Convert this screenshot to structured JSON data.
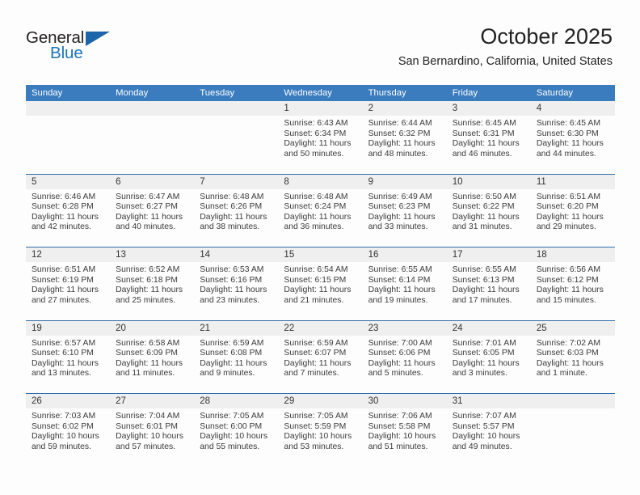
{
  "brand": {
    "word_one": "General",
    "word_two": "Blue",
    "triangle_color": "#1c65ab",
    "blue_color": "#1c75bc"
  },
  "header": {
    "title": "October 2025",
    "location": "San Bernardino, California, United States"
  },
  "theme": {
    "header_row_bg": "#3a7cbe",
    "row_divider": "#2f6fa8",
    "day_number_bg": "#efefef",
    "page_bg": "#fdfdfd"
  },
  "weekdays": [
    "Sunday",
    "Monday",
    "Tuesday",
    "Wednesday",
    "Thursday",
    "Friday",
    "Saturday"
  ],
  "weeks": [
    [
      {
        "day": "",
        "blank": true,
        "sunrise": "",
        "sunset": "",
        "daylight_1": "",
        "daylight_2": ""
      },
      {
        "day": "",
        "blank": true,
        "sunrise": "",
        "sunset": "",
        "daylight_1": "",
        "daylight_2": ""
      },
      {
        "day": "",
        "blank": true,
        "sunrise": "",
        "sunset": "",
        "daylight_1": "",
        "daylight_2": ""
      },
      {
        "day": "1",
        "sunrise": "Sunrise: 6:43 AM",
        "sunset": "Sunset: 6:34 PM",
        "daylight_1": "Daylight: 11 hours",
        "daylight_2": "and 50 minutes."
      },
      {
        "day": "2",
        "sunrise": "Sunrise: 6:44 AM",
        "sunset": "Sunset: 6:32 PM",
        "daylight_1": "Daylight: 11 hours",
        "daylight_2": "and 48 minutes."
      },
      {
        "day": "3",
        "sunrise": "Sunrise: 6:45 AM",
        "sunset": "Sunset: 6:31 PM",
        "daylight_1": "Daylight: 11 hours",
        "daylight_2": "and 46 minutes."
      },
      {
        "day": "4",
        "sunrise": "Sunrise: 6:45 AM",
        "sunset": "Sunset: 6:30 PM",
        "daylight_1": "Daylight: 11 hours",
        "daylight_2": "and 44 minutes."
      }
    ],
    [
      {
        "day": "5",
        "sunrise": "Sunrise: 6:46 AM",
        "sunset": "Sunset: 6:28 PM",
        "daylight_1": "Daylight: 11 hours",
        "daylight_2": "and 42 minutes."
      },
      {
        "day": "6",
        "sunrise": "Sunrise: 6:47 AM",
        "sunset": "Sunset: 6:27 PM",
        "daylight_1": "Daylight: 11 hours",
        "daylight_2": "and 40 minutes."
      },
      {
        "day": "7",
        "sunrise": "Sunrise: 6:48 AM",
        "sunset": "Sunset: 6:26 PM",
        "daylight_1": "Daylight: 11 hours",
        "daylight_2": "and 38 minutes."
      },
      {
        "day": "8",
        "sunrise": "Sunrise: 6:48 AM",
        "sunset": "Sunset: 6:24 PM",
        "daylight_1": "Daylight: 11 hours",
        "daylight_2": "and 36 minutes."
      },
      {
        "day": "9",
        "sunrise": "Sunrise: 6:49 AM",
        "sunset": "Sunset: 6:23 PM",
        "daylight_1": "Daylight: 11 hours",
        "daylight_2": "and 33 minutes."
      },
      {
        "day": "10",
        "sunrise": "Sunrise: 6:50 AM",
        "sunset": "Sunset: 6:22 PM",
        "daylight_1": "Daylight: 11 hours",
        "daylight_2": "and 31 minutes."
      },
      {
        "day": "11",
        "sunrise": "Sunrise: 6:51 AM",
        "sunset": "Sunset: 6:20 PM",
        "daylight_1": "Daylight: 11 hours",
        "daylight_2": "and 29 minutes."
      }
    ],
    [
      {
        "day": "12",
        "sunrise": "Sunrise: 6:51 AM",
        "sunset": "Sunset: 6:19 PM",
        "daylight_1": "Daylight: 11 hours",
        "daylight_2": "and 27 minutes."
      },
      {
        "day": "13",
        "sunrise": "Sunrise: 6:52 AM",
        "sunset": "Sunset: 6:18 PM",
        "daylight_1": "Daylight: 11 hours",
        "daylight_2": "and 25 minutes."
      },
      {
        "day": "14",
        "sunrise": "Sunrise: 6:53 AM",
        "sunset": "Sunset: 6:16 PM",
        "daylight_1": "Daylight: 11 hours",
        "daylight_2": "and 23 minutes."
      },
      {
        "day": "15",
        "sunrise": "Sunrise: 6:54 AM",
        "sunset": "Sunset: 6:15 PM",
        "daylight_1": "Daylight: 11 hours",
        "daylight_2": "and 21 minutes."
      },
      {
        "day": "16",
        "sunrise": "Sunrise: 6:55 AM",
        "sunset": "Sunset: 6:14 PM",
        "daylight_1": "Daylight: 11 hours",
        "daylight_2": "and 19 minutes."
      },
      {
        "day": "17",
        "sunrise": "Sunrise: 6:55 AM",
        "sunset": "Sunset: 6:13 PM",
        "daylight_1": "Daylight: 11 hours",
        "daylight_2": "and 17 minutes."
      },
      {
        "day": "18",
        "sunrise": "Sunrise: 6:56 AM",
        "sunset": "Sunset: 6:12 PM",
        "daylight_1": "Daylight: 11 hours",
        "daylight_2": "and 15 minutes."
      }
    ],
    [
      {
        "day": "19",
        "sunrise": "Sunrise: 6:57 AM",
        "sunset": "Sunset: 6:10 PM",
        "daylight_1": "Daylight: 11 hours",
        "daylight_2": "and 13 minutes."
      },
      {
        "day": "20",
        "sunrise": "Sunrise: 6:58 AM",
        "sunset": "Sunset: 6:09 PM",
        "daylight_1": "Daylight: 11 hours",
        "daylight_2": "and 11 minutes."
      },
      {
        "day": "21",
        "sunrise": "Sunrise: 6:59 AM",
        "sunset": "Sunset: 6:08 PM",
        "daylight_1": "Daylight: 11 hours",
        "daylight_2": "and 9 minutes."
      },
      {
        "day": "22",
        "sunrise": "Sunrise: 6:59 AM",
        "sunset": "Sunset: 6:07 PM",
        "daylight_1": "Daylight: 11 hours",
        "daylight_2": "and 7 minutes."
      },
      {
        "day": "23",
        "sunrise": "Sunrise: 7:00 AM",
        "sunset": "Sunset: 6:06 PM",
        "daylight_1": "Daylight: 11 hours",
        "daylight_2": "and 5 minutes."
      },
      {
        "day": "24",
        "sunrise": "Sunrise: 7:01 AM",
        "sunset": "Sunset: 6:05 PM",
        "daylight_1": "Daylight: 11 hours",
        "daylight_2": "and 3 minutes."
      },
      {
        "day": "25",
        "sunrise": "Sunrise: 7:02 AM",
        "sunset": "Sunset: 6:03 PM",
        "daylight_1": "Daylight: 11 hours",
        "daylight_2": "and 1 minute."
      }
    ],
    [
      {
        "day": "26",
        "sunrise": "Sunrise: 7:03 AM",
        "sunset": "Sunset: 6:02 PM",
        "daylight_1": "Daylight: 10 hours",
        "daylight_2": "and 59 minutes."
      },
      {
        "day": "27",
        "sunrise": "Sunrise: 7:04 AM",
        "sunset": "Sunset: 6:01 PM",
        "daylight_1": "Daylight: 10 hours",
        "daylight_2": "and 57 minutes."
      },
      {
        "day": "28",
        "sunrise": "Sunrise: 7:05 AM",
        "sunset": "Sunset: 6:00 PM",
        "daylight_1": "Daylight: 10 hours",
        "daylight_2": "and 55 minutes."
      },
      {
        "day": "29",
        "sunrise": "Sunrise: 7:05 AM",
        "sunset": "Sunset: 5:59 PM",
        "daylight_1": "Daylight: 10 hours",
        "daylight_2": "and 53 minutes."
      },
      {
        "day": "30",
        "sunrise": "Sunrise: 7:06 AM",
        "sunset": "Sunset: 5:58 PM",
        "daylight_1": "Daylight: 10 hours",
        "daylight_2": "and 51 minutes."
      },
      {
        "day": "31",
        "sunrise": "Sunrise: 7:07 AM",
        "sunset": "Sunset: 5:57 PM",
        "daylight_1": "Daylight: 10 hours",
        "daylight_2": "and 49 minutes."
      },
      {
        "day": "",
        "blank": true,
        "sunrise": "",
        "sunset": "",
        "daylight_1": "",
        "daylight_2": ""
      }
    ]
  ]
}
